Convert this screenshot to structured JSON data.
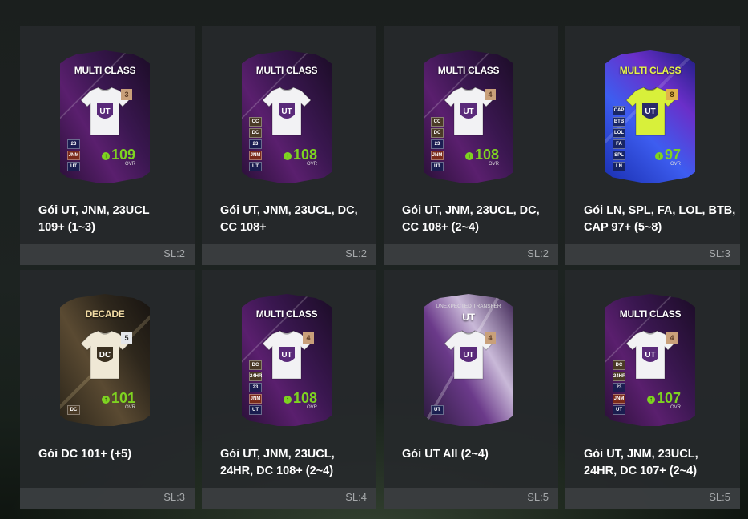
{
  "packs": [
    {
      "label": "MULTI CLASS",
      "style": "purple",
      "shirt": "white",
      "num": "3",
      "numStyle": "",
      "badges": [
        {
          "t": "23",
          "c": ""
        },
        {
          "t": "JNM",
          "c": "jnm"
        },
        {
          "t": "UT",
          "c": ""
        }
      ],
      "ovr": "109",
      "title": "Gói UT, JNM, 23UCL\n109+ (1~3)",
      "sl": "SL:2"
    },
    {
      "label": "MULTI CLASS",
      "style": "purple",
      "shirt": "white",
      "num": "",
      "numStyle": "",
      "badges": [
        {
          "t": "CC",
          "c": "cc"
        },
        {
          "t": "DC",
          "c": "dc"
        },
        {
          "t": "23",
          "c": ""
        },
        {
          "t": "JNM",
          "c": "jnm"
        },
        {
          "t": "UT",
          "c": ""
        }
      ],
      "ovr": "108",
      "title": "Gói UT, JNM, 23UCL, DC,\nCC 108+",
      "sl": "SL:2"
    },
    {
      "label": "MULTI CLASS",
      "style": "purple",
      "shirt": "white",
      "num": "4",
      "numStyle": "",
      "badges": [
        {
          "t": "CC",
          "c": "cc"
        },
        {
          "t": "DC",
          "c": "dc"
        },
        {
          "t": "23",
          "c": ""
        },
        {
          "t": "JNM",
          "c": "jnm"
        },
        {
          "t": "UT",
          "c": ""
        }
      ],
      "ovr": "108",
      "title": "Gói UT, JNM, 23UCL, DC,\nCC 108+ (2~4)",
      "sl": "SL:2"
    },
    {
      "label": "MULTI CLASS",
      "style": "blue",
      "shirt": "yellow",
      "num": "8",
      "numStyle": "yellow",
      "badges": [
        {
          "t": "CAP",
          "c": ""
        },
        {
          "t": "BTB",
          "c": ""
        },
        {
          "t": "LOL",
          "c": ""
        },
        {
          "t": "FA",
          "c": ""
        },
        {
          "t": "SPL",
          "c": ""
        },
        {
          "t": "LN",
          "c": ""
        }
      ],
      "ovr": "97",
      "title": "Gói LN, SPL, FA, LOL, BTB,\nCAP 97+ (5~8)",
      "sl": "SL:3"
    },
    {
      "label": "DECADE",
      "style": "gold",
      "shirt": "cream",
      "num": "5",
      "numStyle": "light",
      "badges": [
        {
          "t": "DC",
          "c": "dc"
        }
      ],
      "ovr": "101",
      "title": "Gói DC 101+ (+5)",
      "sl": "SL:3"
    },
    {
      "label": "MULTI CLASS",
      "style": "purple",
      "shirt": "white",
      "num": "4",
      "numStyle": "",
      "badges": [
        {
          "t": "DC",
          "c": "dc"
        },
        {
          "t": "24HR",
          "c": "hr"
        },
        {
          "t": "23",
          "c": ""
        },
        {
          "t": "JNM",
          "c": "jnm"
        },
        {
          "t": "UT",
          "c": ""
        }
      ],
      "ovr": "108",
      "title": "Gói UT, JNM, 23UCL,\n24HR, DC 108+ (2~4)",
      "sl": "SL:4"
    },
    {
      "label": "UT",
      "sublabel": "UNEXPECTED TRANSFER",
      "style": "ut",
      "shirt": "white",
      "num": "4",
      "numStyle": "",
      "badges": [
        {
          "t": "UT",
          "c": ""
        }
      ],
      "ovr": "",
      "title": "Gói UT All (2~4)",
      "sl": "SL:5"
    },
    {
      "label": "MULTI CLASS",
      "style": "purple",
      "shirt": "white",
      "num": "4",
      "numStyle": "",
      "badges": [
        {
          "t": "DC",
          "c": "dc"
        },
        {
          "t": "24HR",
          "c": "hr"
        },
        {
          "t": "23",
          "c": ""
        },
        {
          "t": "JNM",
          "c": "jnm"
        },
        {
          "t": "UT",
          "c": ""
        }
      ],
      "ovr": "107",
      "title": "Gói UT, JNM, 23UCL,\n24HR, DC 107+ (2~4)",
      "sl": "SL:5"
    }
  ],
  "ovr_caption": "OVR",
  "icons": {
    "upgrade": "upgrade-arrow-icon"
  }
}
